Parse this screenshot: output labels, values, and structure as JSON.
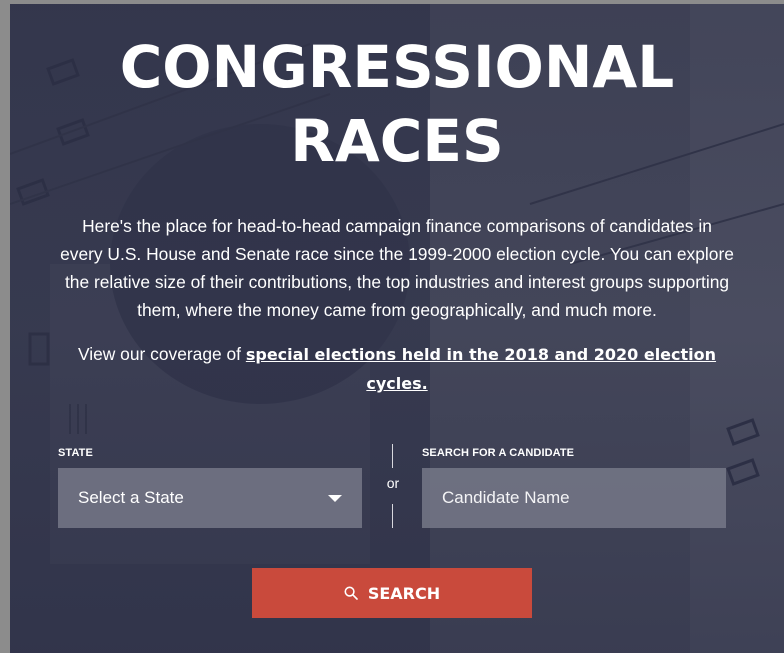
{
  "title_line1": "CONGRESSIONAL",
  "title_line2": "RACES",
  "intro_text": "Here's the place for head-to-head campaign finance comparisons of candidates in every U.S. House and Senate race since the 1999-2000 election cycle. You can explore the relative size of their contributions, the top industries and interest groups supporting them, where the money came from geographically, and much more.",
  "special": {
    "prefix": "View our coverage of ",
    "link_text": "special elections held in the 2018 and 2020 election cycles."
  },
  "state_field": {
    "label": "STATE",
    "selected": "Select a State"
  },
  "or_text": "or",
  "candidate_field": {
    "label": "SEARCH FOR A CANDIDATE",
    "placeholder": "Candidate Name",
    "value": ""
  },
  "search_button": {
    "label": "SEARCH",
    "icon": "search-icon"
  },
  "colors": {
    "overlay": "#282b42",
    "field_bg": "#787a8a",
    "button": "#c94a3c",
    "text": "#ffffff"
  }
}
